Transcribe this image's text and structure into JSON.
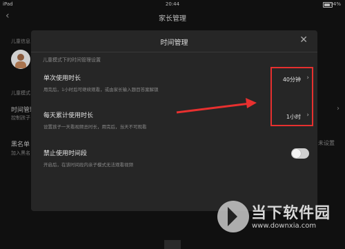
{
  "status": {
    "device": "iPad",
    "time": "20:44",
    "battery": "94%"
  },
  "background": {
    "header_title": "家长管理",
    "section1_label": "儿童信息",
    "section2_label": "儿童模式",
    "time_mgmt_label": "时间管理",
    "time_mgmt_desc": "控制孩子",
    "blacklist_label": "黑名单",
    "blacklist_desc": "加入黑名",
    "right_hint": "未设置"
  },
  "modal": {
    "title": "时间管理",
    "subtitle": "儿童模式下的时间管理设置",
    "rows": [
      {
        "title": "单次使用时长",
        "desc": "用完后，1小时后可继续观看，或由家长输入题目答案解锁",
        "value": "40分钟"
      },
      {
        "title": "每天累计使用时长",
        "desc": "设置孩子一天看视频总时长，用完后，当天不可观看",
        "value": "1小时"
      },
      {
        "title": "禁止使用时间段",
        "desc": "开启后，在该时间段内亲子模式无法观看视频",
        "toggle_on": false
      }
    ]
  },
  "watermark": {
    "brand": "当下软件园",
    "url": "www.downxia.com"
  },
  "colors": {
    "accent_red": "#e8302f",
    "modal_bg": "#262626",
    "page_bg": "#101010"
  }
}
